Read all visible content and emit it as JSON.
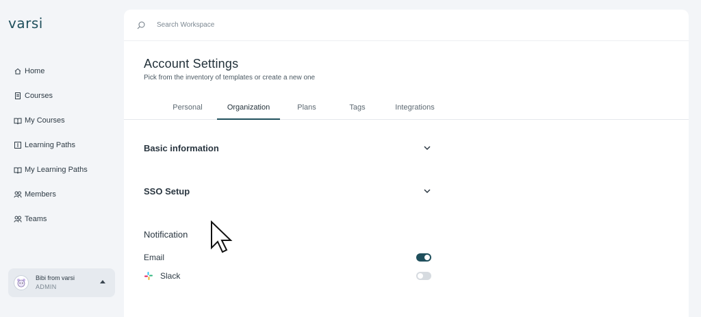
{
  "brand": {
    "logo_text": "varsi"
  },
  "sidebar": {
    "items": [
      {
        "label": "Home",
        "icon": "home-icon"
      },
      {
        "label": "Courses",
        "icon": "document-icon"
      },
      {
        "label": "My Courses",
        "icon": "book-open-icon"
      },
      {
        "label": "Learning Paths",
        "icon": "path-book-icon"
      },
      {
        "label": "My Learning Paths",
        "icon": "book-open-icon"
      },
      {
        "label": "Members",
        "icon": "users-icon"
      },
      {
        "label": "Teams",
        "icon": "users-icon"
      }
    ]
  },
  "user": {
    "name": "Bibi from varsi",
    "role": "ADMIN"
  },
  "search": {
    "placeholder": "Search Workspace"
  },
  "header": {
    "title": "Account Settings",
    "subtitle": "Pick from the inventory of templates or create a new one"
  },
  "tabs": [
    {
      "label": "Personal",
      "active": false
    },
    {
      "label": "Organization",
      "active": true
    },
    {
      "label": "Plans",
      "active": false
    },
    {
      "label": "Tags",
      "active": false
    },
    {
      "label": "Integrations",
      "active": false
    }
  ],
  "sections": {
    "basic_info": "Basic information",
    "sso": "SSO Setup"
  },
  "notification": {
    "title": "Notification",
    "email": {
      "label": "Email",
      "enabled": true
    },
    "slack": {
      "label": "Slack",
      "enabled": false
    }
  },
  "colors": {
    "accent": "#1f4f5c",
    "toggle_off": "#d6dbe0"
  }
}
